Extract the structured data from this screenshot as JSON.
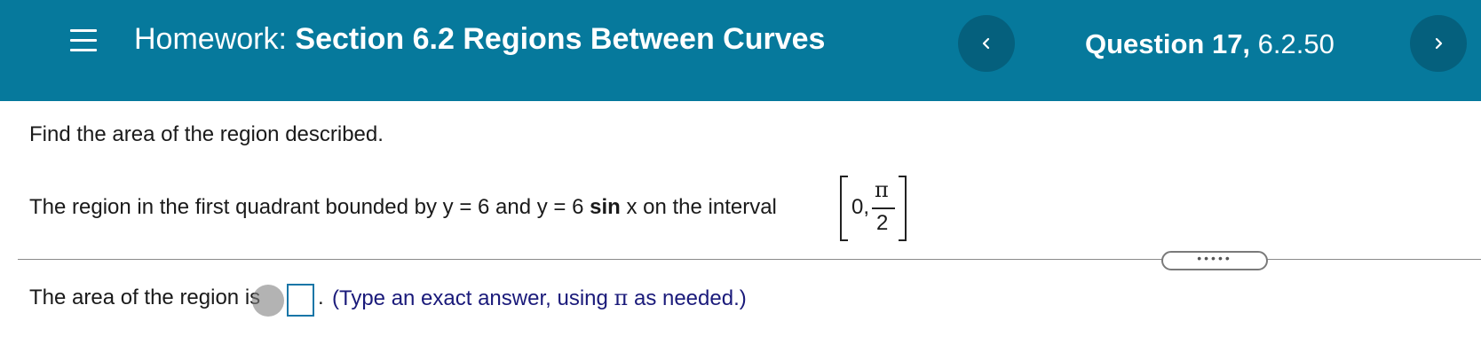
{
  "header": {
    "title_prefix": "Homework:",
    "title_bold": "Section 6.2 Regions Between Curves",
    "question_bold": "Question 17,",
    "question_id": "6.2.50",
    "prev_icon": "chevron-left-icon",
    "next_icon": "chevron-right-icon",
    "menu_icon": "hamburger-menu-icon",
    "background_color": "#06799c"
  },
  "problem": {
    "instructions": "Find the area of the region described.",
    "statement_before_sin": "The region in the first quadrant bounded by y = 6 and y = 6",
    "sin_word": "sin",
    "statement_after_sin": "x on the interval",
    "interval_start": "0,",
    "interval_end_numerator": "π",
    "interval_end_denominator": "2"
  },
  "more_button": "•••••",
  "answer": {
    "lead_text": "The area of the region is",
    "value": "",
    "period": ".",
    "hint_before_pi": "(Type an exact answer, using",
    "hint_pi": "π",
    "hint_after_pi": "as needed.)"
  }
}
